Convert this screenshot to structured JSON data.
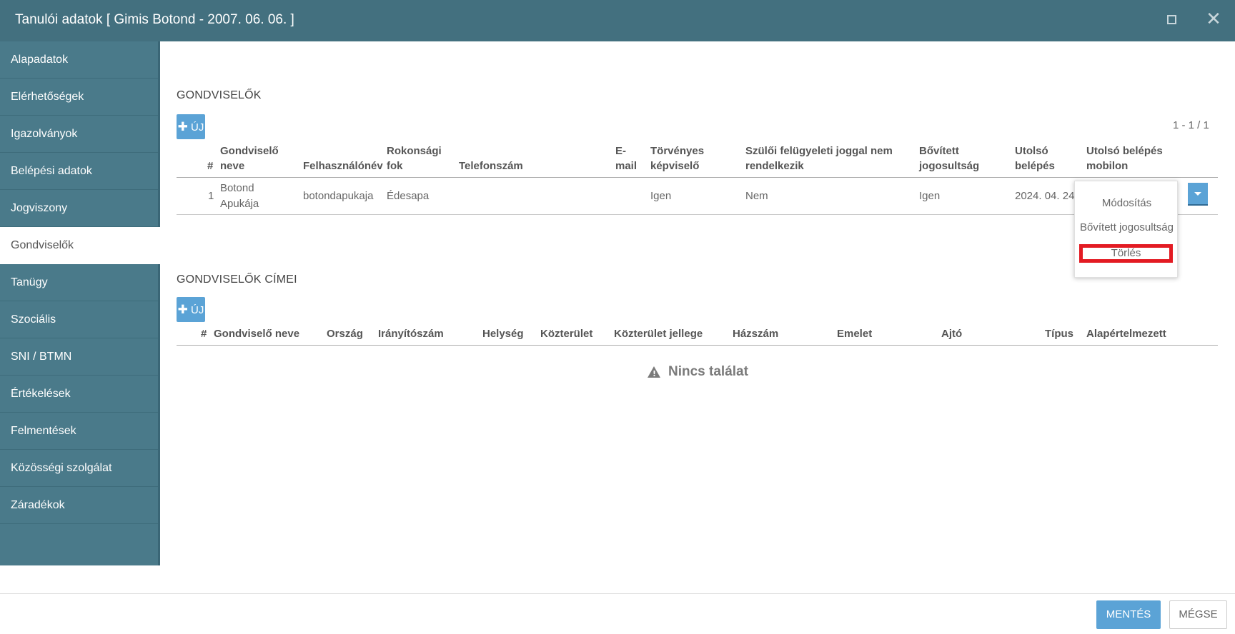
{
  "window": {
    "title": "Tanulói adatok [ Gimis Botond - 2007. 06. 06. ]",
    "maximize_icon": "maximize-icon",
    "close_icon": "close-icon",
    "close_glyph": "✕"
  },
  "sidebar": {
    "items": [
      {
        "label": "Alapadatok"
      },
      {
        "label": "Elérhetőségek"
      },
      {
        "label": "Igazolványok"
      },
      {
        "label": "Belépési adatok"
      },
      {
        "label": "Jogviszony"
      },
      {
        "label": "Gondviselők"
      },
      {
        "label": "Tanügy"
      },
      {
        "label": "Szociális"
      },
      {
        "label": "SNI / BTMN"
      },
      {
        "label": "Értékelések"
      },
      {
        "label": "Felmentések"
      },
      {
        "label": "Közösségi szolgálat"
      },
      {
        "label": "Záradékok"
      }
    ],
    "active": "Gondviselők"
  },
  "guardians": {
    "section_title": "GONDVISELŐK",
    "new_label": "ÚJ",
    "plus_glyph": "✚",
    "pager": "1 - 1 / 1",
    "columns": {
      "num": "#",
      "name_1": "Gondviselő",
      "name_2": "neve",
      "username": "Felhasználónév",
      "relation_1": "Rokonsági",
      "relation_2": "fok",
      "phone": "Telefonszám",
      "email_1": "E-",
      "email_2": "mail",
      "legal_rep_1": "Törvényes",
      "legal_rep_2": "képviselő",
      "no_custody_1": "Szülői felügyeleti joggal nem",
      "no_custody_2": "rendelkezik",
      "extended_1": "Bővített",
      "extended_2": "jogosultság",
      "last_login_1": "Utolsó",
      "last_login_2": "belépés",
      "last_mobile_1": "Utolsó belépés",
      "last_mobile_2": "mobilon"
    },
    "rows": [
      {
        "num": "1",
        "name_1": "Botond",
        "name_2": "Apukája",
        "username": "botondapukaja",
        "relation": "Édesapa",
        "phone": "",
        "email": "",
        "legal_rep": "Igen",
        "no_custody": "Nem",
        "extended": "Igen",
        "last_login": "2024. 04. 24",
        "last_mobile": ""
      }
    ],
    "row_menu": {
      "items": [
        "Módosítás",
        "Bővített jogosultság",
        "Törlés"
      ],
      "highlighted": "Törlés"
    }
  },
  "addresses": {
    "section_title": "GONDVISELŐK CÍMEI",
    "new_label": "ÚJ",
    "columns": {
      "num": "#",
      "name": "Gondviselő neve",
      "country": "Ország",
      "zip": "Irányítószám",
      "city": "Helység",
      "street": "Közterület",
      "street_type": "Közterület jellege",
      "house_no": "Házszám",
      "floor": "Emelet",
      "door": "Ajtó",
      "type": "Típus",
      "default": "Alapértelmezett"
    },
    "empty_text": "Nincs találat",
    "warning_glyph": "!"
  },
  "footer": {
    "save_label": "MENTÉS",
    "cancel_label": "MÉGSE"
  },
  "colors": {
    "titlebar": "#43707f",
    "sidebar": "#4a7a8a",
    "accent_button": "#5ba3d6",
    "highlight": "#e31b23"
  }
}
